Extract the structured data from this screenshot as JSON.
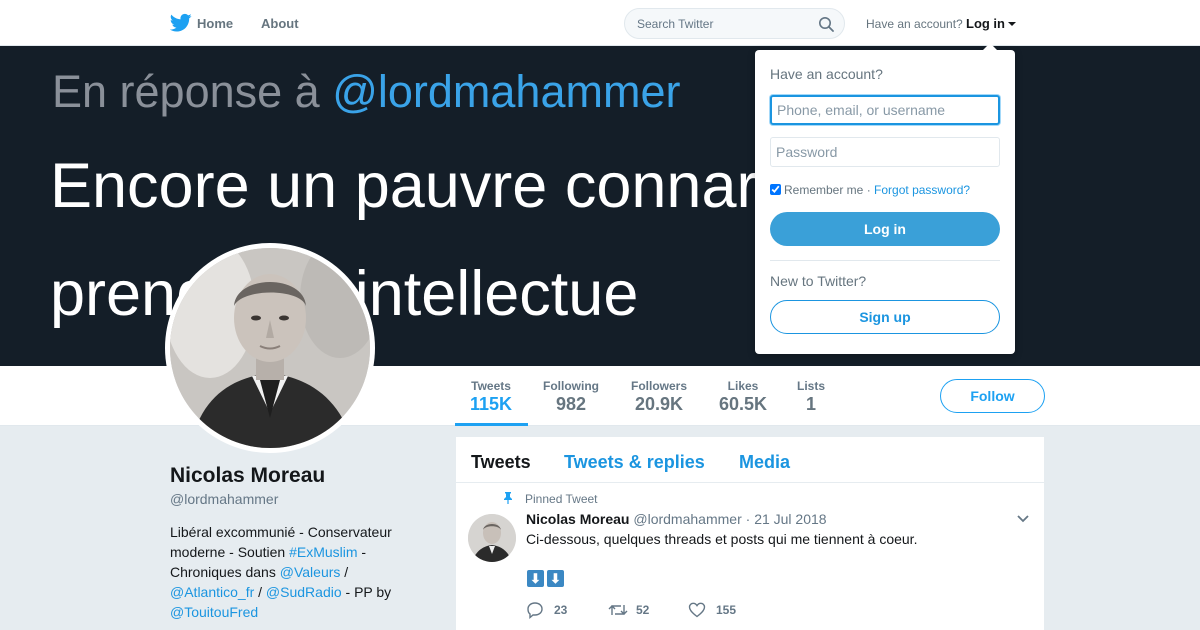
{
  "nav": {
    "home_label": "Home",
    "about_label": "About",
    "search_placeholder": "Search Twitter",
    "have_account_label": "Have an account?",
    "login_label": "Log in",
    "logo_icon": "twitter-bird-icon",
    "search_icon": "search-icon"
  },
  "banner": {
    "line1_prefix": "En réponse à ",
    "line1_mention": "@lordmahammer",
    "line2": "Encore un pauvre connar",
    "line3": "prend  r un intellectue"
  },
  "stats": [
    {
      "label": "Tweets",
      "value": "115K"
    },
    {
      "label": "Following",
      "value": "982"
    },
    {
      "label": "Followers",
      "value": "20.9K"
    },
    {
      "label": "Likes",
      "value": "60.5K"
    },
    {
      "label": "Lists",
      "value": "1"
    }
  ],
  "follow_label": "Follow",
  "profile": {
    "name": "Nicolas Moreau",
    "handle": "@lordmahammer",
    "bio_1": "Libéral excommunié - Conservateur moderne - Soutien ",
    "bio_hashtag": "#ExMuslim",
    "bio_2": " - Chroniques dans ",
    "bio_m1": "@Valeurs",
    "bio_3": " / ",
    "bio_m2": "@Atlantico_fr",
    "bio_4": " / ",
    "bio_m3": "@SudRadio",
    "bio_5": " - PP by ",
    "bio_m4": "@TouitouFred"
  },
  "timeline": {
    "tabs": [
      "Tweets",
      "Tweets & replies",
      "Media"
    ],
    "pinned_label": "Pinned Tweet",
    "tweet": {
      "name": "Nicolas Moreau",
      "handle": "@lordmahammer",
      "separator": "·",
      "date": "21 Jul 2018",
      "text": "Ci-dessous, quelques threads et posts qui me tiennent à coeur.",
      "emoji": [
        "⬇",
        "⬇"
      ],
      "replies": "23",
      "retweets": "52",
      "likes": "155"
    }
  },
  "login_dropdown": {
    "title": "Have an account?",
    "username_placeholder": "Phone, email, or username",
    "password_placeholder": "Password",
    "remember_label": "Remember me",
    "separator": "·",
    "forgot_label": "Forgot password?",
    "login_button": "Log in",
    "new_label": "New to Twitter?",
    "signup_button": "Sign up"
  },
  "colors": {
    "accent": "#1da1f2",
    "banner_bg": "#141e28",
    "login_button": "#3aa0d8"
  }
}
